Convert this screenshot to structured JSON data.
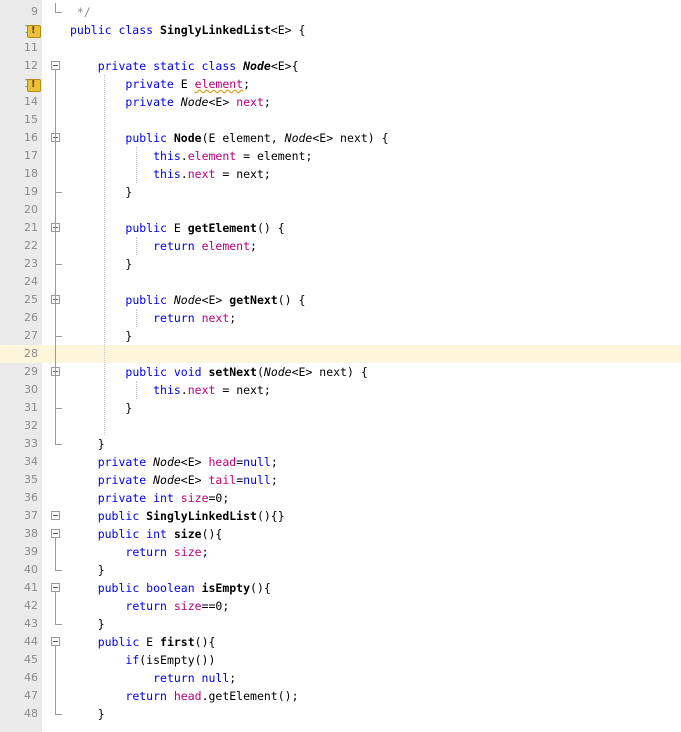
{
  "editor": {
    "current_line": 28,
    "lines": [
      {
        "n": "9",
        "tokens": [
          [
            "cmt",
            " */"
          ]
        ]
      },
      {
        "n": "10",
        "tokens": [
          [
            "kw",
            "public class "
          ],
          [
            "mth",
            "SinglyLinkedList"
          ],
          [
            "",
            "<E> {"
          ]
        ],
        "warn": true
      },
      {
        "n": "11",
        "tokens": []
      },
      {
        "n": "12",
        "tokens": [
          [
            "",
            "    "
          ],
          [
            "kw",
            "private static class "
          ],
          [
            "tp mth",
            "Node"
          ],
          [
            "",
            "<E>{"
          ]
        ]
      },
      {
        "n": "13",
        "tokens": [
          [
            "",
            "        "
          ],
          [
            "kw",
            "private "
          ],
          [
            "",
            "E "
          ],
          [
            "fld squiggle",
            "element"
          ],
          [
            "",
            ";"
          ]
        ],
        "warn": true
      },
      {
        "n": "14",
        "tokens": [
          [
            "",
            "        "
          ],
          [
            "kw",
            "private "
          ],
          [
            "tp",
            "Node"
          ],
          [
            "",
            "<E> "
          ],
          [
            "fld",
            "next"
          ],
          [
            "",
            ";"
          ]
        ]
      },
      {
        "n": "15",
        "tokens": []
      },
      {
        "n": "16",
        "tokens": [
          [
            "",
            "        "
          ],
          [
            "kw",
            "public "
          ],
          [
            "mth",
            "Node"
          ],
          [
            "",
            "(E element, "
          ],
          [
            "tp",
            "Node"
          ],
          [
            "",
            "<E> next) {"
          ]
        ]
      },
      {
        "n": "17",
        "tokens": [
          [
            "",
            "            "
          ],
          [
            "kw",
            "this"
          ],
          [
            "",
            "."
          ],
          [
            "fld",
            "element"
          ],
          [
            "",
            " = element;"
          ]
        ]
      },
      {
        "n": "18",
        "tokens": [
          [
            "",
            "            "
          ],
          [
            "kw",
            "this"
          ],
          [
            "",
            "."
          ],
          [
            "fld",
            "next"
          ],
          [
            "",
            " = next;"
          ]
        ]
      },
      {
        "n": "19",
        "tokens": [
          [
            "",
            "        }"
          ]
        ]
      },
      {
        "n": "20",
        "tokens": []
      },
      {
        "n": "21",
        "tokens": [
          [
            "",
            "        "
          ],
          [
            "kw",
            "public "
          ],
          [
            "",
            "E "
          ],
          [
            "mth",
            "getElement"
          ],
          [
            "",
            "() {"
          ]
        ]
      },
      {
        "n": "22",
        "tokens": [
          [
            "",
            "            "
          ],
          [
            "kw",
            "return "
          ],
          [
            "fld",
            "element"
          ],
          [
            "",
            ";"
          ]
        ]
      },
      {
        "n": "23",
        "tokens": [
          [
            "",
            "        }"
          ]
        ]
      },
      {
        "n": "24",
        "tokens": []
      },
      {
        "n": "25",
        "tokens": [
          [
            "",
            "        "
          ],
          [
            "kw",
            "public "
          ],
          [
            "tp",
            "Node"
          ],
          [
            "",
            "<E> "
          ],
          [
            "mth",
            "getNext"
          ],
          [
            "",
            "() {"
          ]
        ]
      },
      {
        "n": "26",
        "tokens": [
          [
            "",
            "            "
          ],
          [
            "kw",
            "return "
          ],
          [
            "fld",
            "next"
          ],
          [
            "",
            ";"
          ]
        ]
      },
      {
        "n": "27",
        "tokens": [
          [
            "",
            "        }"
          ]
        ]
      },
      {
        "n": "28",
        "tokens": []
      },
      {
        "n": "29",
        "tokens": [
          [
            "",
            "        "
          ],
          [
            "kw",
            "public void "
          ],
          [
            "mth",
            "setNext"
          ],
          [
            "",
            "("
          ],
          [
            "tp",
            "Node"
          ],
          [
            "",
            "<E> next) {"
          ]
        ]
      },
      {
        "n": "30",
        "tokens": [
          [
            "",
            "            "
          ],
          [
            "kw",
            "this"
          ],
          [
            "",
            "."
          ],
          [
            "fld",
            "next"
          ],
          [
            "",
            " = next;"
          ]
        ]
      },
      {
        "n": "31",
        "tokens": [
          [
            "",
            "        }"
          ]
        ]
      },
      {
        "n": "32",
        "tokens": []
      },
      {
        "n": "33",
        "tokens": [
          [
            "",
            "    }"
          ]
        ]
      },
      {
        "n": "34",
        "tokens": [
          [
            "",
            "    "
          ],
          [
            "kw",
            "private "
          ],
          [
            "tp",
            "Node"
          ],
          [
            "",
            "<E> "
          ],
          [
            "fld",
            "head"
          ],
          [
            "",
            "="
          ],
          [
            "kw",
            "null"
          ],
          [
            "",
            ";"
          ]
        ]
      },
      {
        "n": "35",
        "tokens": [
          [
            "",
            "    "
          ],
          [
            "kw",
            "private "
          ],
          [
            "tp",
            "Node"
          ],
          [
            "",
            "<E> "
          ],
          [
            "fld",
            "tail"
          ],
          [
            "",
            "="
          ],
          [
            "kw",
            "null"
          ],
          [
            "",
            ";"
          ]
        ]
      },
      {
        "n": "36",
        "tokens": [
          [
            "",
            "    "
          ],
          [
            "kw",
            "private int "
          ],
          [
            "fld",
            "size"
          ],
          [
            "",
            "=0;"
          ]
        ]
      },
      {
        "n": "37",
        "tokens": [
          [
            "",
            "    "
          ],
          [
            "kw",
            "public "
          ],
          [
            "mth",
            "SinglyLinkedList"
          ],
          [
            "",
            "(){}"
          ]
        ]
      },
      {
        "n": "38",
        "tokens": [
          [
            "",
            "    "
          ],
          [
            "kw",
            "public int "
          ],
          [
            "mth",
            "size"
          ],
          [
            "",
            "(){"
          ]
        ]
      },
      {
        "n": "39",
        "tokens": [
          [
            "",
            "        "
          ],
          [
            "kw",
            "return "
          ],
          [
            "fld",
            "size"
          ],
          [
            "",
            ";"
          ]
        ]
      },
      {
        "n": "40",
        "tokens": [
          [
            "",
            "    }"
          ]
        ]
      },
      {
        "n": "41",
        "tokens": [
          [
            "",
            "    "
          ],
          [
            "kw",
            "public boolean "
          ],
          [
            "mth",
            "isEmpty"
          ],
          [
            "",
            "(){"
          ]
        ]
      },
      {
        "n": "42",
        "tokens": [
          [
            "",
            "        "
          ],
          [
            "kw",
            "return "
          ],
          [
            "fld",
            "size"
          ],
          [
            "",
            "==0;"
          ]
        ]
      },
      {
        "n": "43",
        "tokens": [
          [
            "",
            "    }"
          ]
        ]
      },
      {
        "n": "44",
        "tokens": [
          [
            "",
            "    "
          ],
          [
            "kw",
            "public "
          ],
          [
            "",
            "E "
          ],
          [
            "mth",
            "first"
          ],
          [
            "",
            "(){"
          ]
        ]
      },
      {
        "n": "45",
        "tokens": [
          [
            "",
            "        "
          ],
          [
            "kw",
            "if"
          ],
          [
            "",
            "(isEmpty())"
          ]
        ]
      },
      {
        "n": "46",
        "tokens": [
          [
            "",
            "            "
          ],
          [
            "kw",
            "return null"
          ],
          [
            "",
            ";"
          ]
        ]
      },
      {
        "n": "47",
        "tokens": [
          [
            "",
            "        "
          ],
          [
            "kw",
            "return "
          ],
          [
            "fld",
            "head"
          ],
          [
            "",
            ".getElement();"
          ]
        ]
      },
      {
        "n": "48",
        "tokens": [
          [
            "",
            "    }"
          ]
        ]
      }
    ]
  }
}
